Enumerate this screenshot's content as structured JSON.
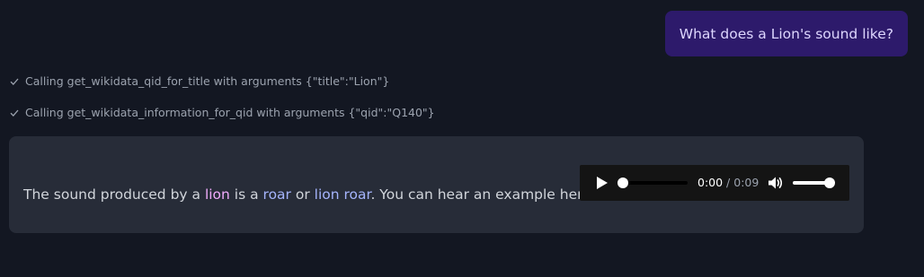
{
  "user_message": "What does a Lion's sound like?",
  "tool_calls": [
    {
      "text": "Calling get_wikidata_qid_for_title with arguments {\"title\":\"Lion\"}",
      "icon": "check-icon"
    },
    {
      "text": "Calling get_wikidata_information_for_qid with arguments {\"qid\":\"Q140\"}",
      "icon": "check-icon"
    }
  ],
  "assistant": {
    "text_1": "The sound produced by a ",
    "link_1": "lion",
    "text_2": " is a ",
    "link_2": "roar",
    "text_3": " or ",
    "link_3": "lion roar",
    "text_4": ". You can hear an example here:"
  },
  "audio": {
    "current_time": "0:00",
    "separator": " / ",
    "duration": "0:09",
    "progress": 0,
    "volume": 1,
    "play_icon": "play-icon",
    "volume_icon": "volume-icon"
  },
  "colors": {
    "background": "#131722",
    "user_bubble": "#2d1a6b",
    "assistant_card": "#272c38",
    "link_pink": "#f0abfc",
    "link_blue": "#a5b4fc"
  }
}
